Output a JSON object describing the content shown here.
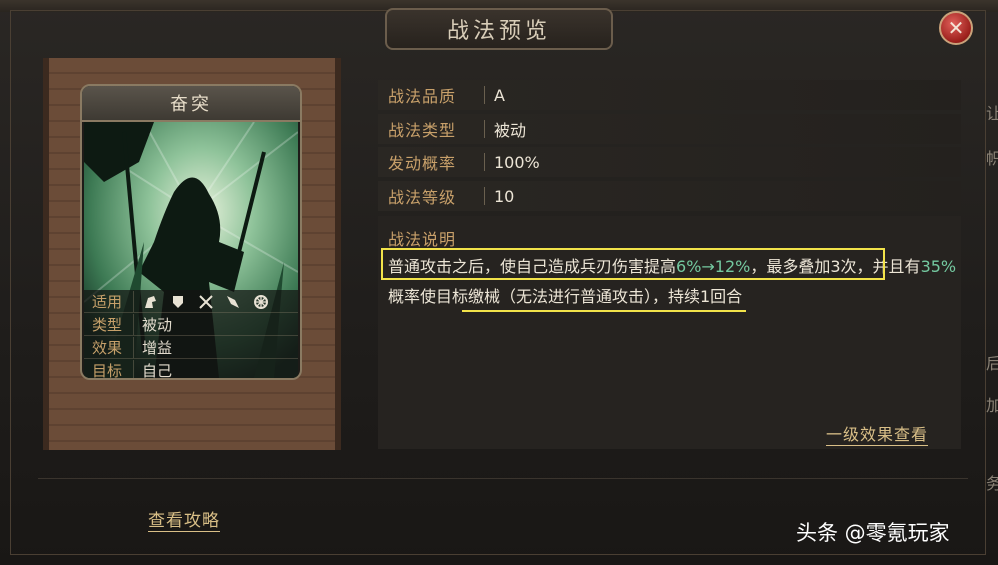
{
  "window": {
    "title": "战法预览",
    "close_icon": "close-icon"
  },
  "card": {
    "name": "奋突",
    "info": [
      {
        "key": "适用",
        "value": "",
        "icons": [
          "cavalry-icon",
          "shield-icon",
          "bow-icon",
          "spear-icon",
          "siege-icon"
        ]
      },
      {
        "key": "类型",
        "value": "被动"
      },
      {
        "key": "效果",
        "value": "增益"
      },
      {
        "key": "目标",
        "value": "自己"
      }
    ]
  },
  "stats": [
    {
      "key": "战法品质",
      "value": "A"
    },
    {
      "key": "战法类型",
      "value": "被动"
    },
    {
      "key": "发动概率",
      "value": "100%"
    },
    {
      "key": "战法等级",
      "value": "10"
    }
  ],
  "description": {
    "title": "战法说明",
    "parts": {
      "p1": "普通攻击之后，使自己造成兵刃伤害提高",
      "p2": "6%→12%",
      "p3": "，最多叠加3次，并且有",
      "p4": "35%",
      "p5": "概率使目标缴械（无法进行普通攻击），持续1回合"
    },
    "accent_color": "#74c9a0"
  },
  "links": {
    "effect": "一级效果查看",
    "guide": "查看攻略"
  },
  "watermark": "头条 @零氪玩家",
  "side_glyphs": [
    "让",
    "帜",
    "后",
    "加",
    "务"
  ]
}
